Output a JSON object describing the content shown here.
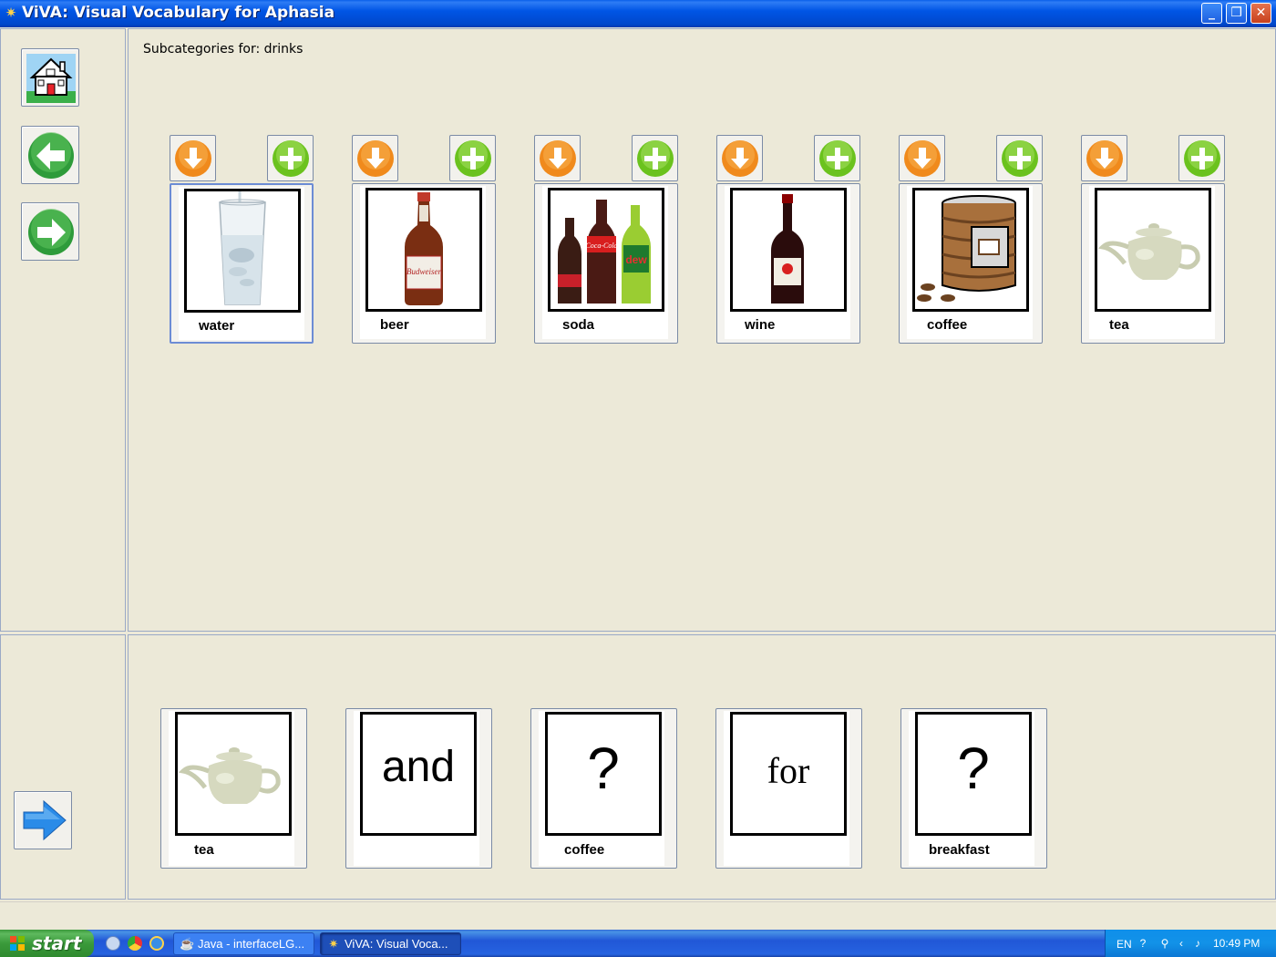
{
  "window": {
    "title": "ViVA: Visual Vocabulary for Aphasia",
    "controls": {
      "minimize": "_",
      "maximize": "❐",
      "close": "✕"
    }
  },
  "nav": {
    "home_icon": "house-icon",
    "back_icon": "arrow-left-icon",
    "forward_icon": "arrow-right-icon",
    "speak_icon": "arrow-right-blue-icon"
  },
  "subcategories": {
    "label": "Subcategories for: drinks",
    "items": [
      {
        "label": "water",
        "icon": "glass-of-water-icon",
        "selected": true
      },
      {
        "label": "beer",
        "icon": "beer-bottle-icon",
        "selected": false
      },
      {
        "label": "soda",
        "icon": "soda-bottles-icon",
        "selected": false
      },
      {
        "label": "wine",
        "icon": "wine-bottle-icon",
        "selected": false
      },
      {
        "label": "coffee",
        "icon": "coffee-can-icon",
        "selected": false
      },
      {
        "label": "tea",
        "icon": "teapot-icon",
        "selected": false
      }
    ]
  },
  "sentence": {
    "items": [
      {
        "label": "tea",
        "type": "image",
        "icon": "teapot-icon"
      },
      {
        "label": "",
        "type": "word",
        "word": "and"
      },
      {
        "label": "coffee",
        "type": "word",
        "word": "?"
      },
      {
        "label": "",
        "type": "word",
        "word": "for"
      },
      {
        "label": "breakfast",
        "type": "word",
        "word": "?"
      }
    ]
  },
  "taskbar": {
    "start": "start",
    "tasks": [
      {
        "label": "Java - interfaceLG...",
        "icon": "java-icon"
      },
      {
        "label": "ViVA: Visual Voca...",
        "icon": "viva-icon"
      }
    ],
    "tray": {
      "language": "EN",
      "clock": "10:49 PM"
    }
  },
  "colors": {
    "titlebar": "#0055E5",
    "window_bg": "#ECE9D8",
    "down_button": "#F08A1C",
    "add_button": "#6BC21E",
    "nav_green": "#2E9B3A",
    "speak_blue": "#2A8BE8"
  }
}
